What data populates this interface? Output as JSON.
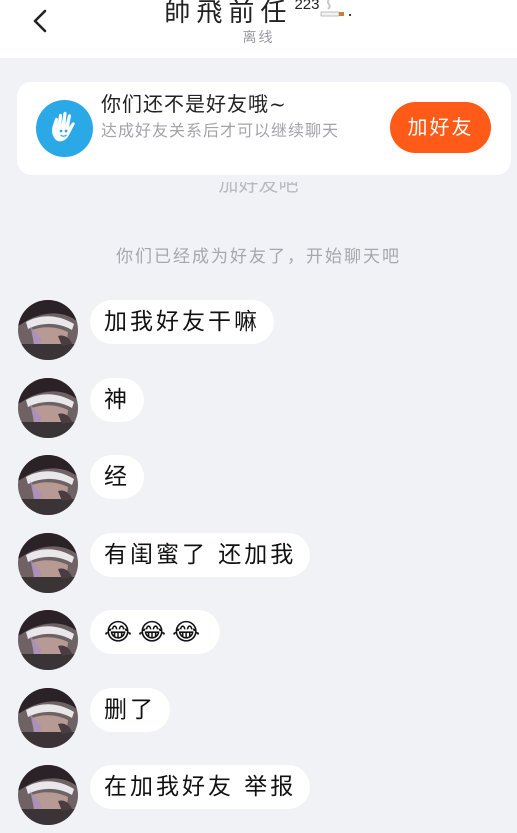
{
  "header": {
    "name": "帥飛前任",
    "count": "223",
    "trailing": ".",
    "status": "离线"
  },
  "friend_card": {
    "title": "你们还不是好友哦~",
    "description": "达成好友关系后才可以继续聊天",
    "button_label": "加好友"
  },
  "system": {
    "partial_text": "加好友吧",
    "message": "你们已经成为好友了，开始聊天吧"
  },
  "messages": [
    {
      "text": "加我好友干嘛"
    },
    {
      "text": "神"
    },
    {
      "text": "经"
    },
    {
      "text": "有闺蜜了 还加我"
    },
    {
      "text": "😂😂😂"
    },
    {
      "text": "删了"
    },
    {
      "text": "在加我好友 举报"
    }
  ],
  "colors": {
    "accent": "#ff5a17",
    "card_icon": "#2aa9e6",
    "background": "#f1f2f6"
  }
}
